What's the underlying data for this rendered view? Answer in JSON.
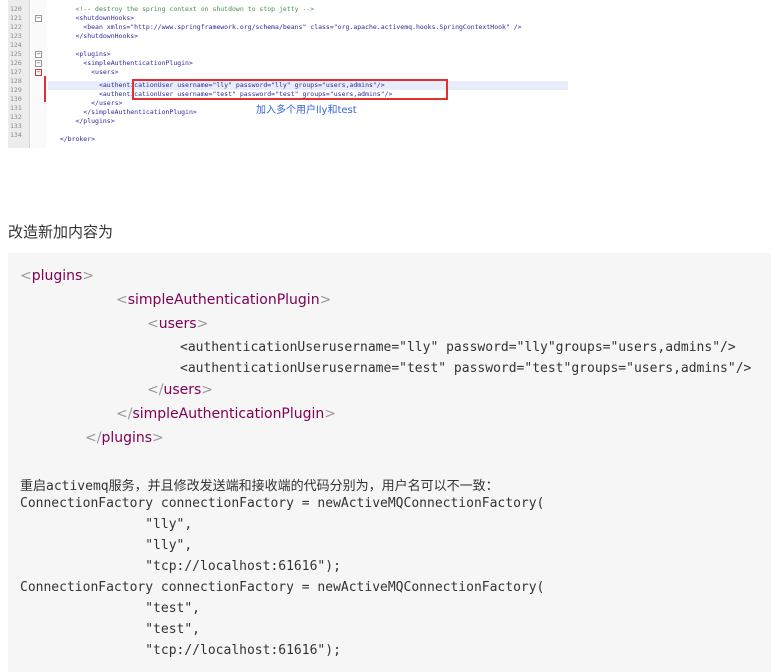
{
  "editor": {
    "line_numbers": [
      "120",
      "121",
      "122",
      "123",
      "124",
      "125",
      "126",
      "127",
      "128",
      "129",
      "130",
      "131",
      "132",
      "133",
      "134"
    ],
    "code_lines": [
      "      <!-- destroy the spring context on shutdown to stop jetty -->",
      "      <shutdownHooks>",
      "        <bean xmlns=\"http://www.springframework.org/schema/beans\" class=\"org.apache.activemq.hooks.SpringContextHook\" />",
      "      </shutdownHooks>",
      "",
      "      <plugins>",
      "        <simpleAuthenticationPlugin>",
      "          <users>",
      "            <authenticationUser username=\"lly\" password=\"lly\" groups=\"users,admins\"/>",
      "            <authenticationUser username=\"test\" password=\"test\" groups=\"users,admins\"/>",
      "          </users>",
      "        </simpleAuthenticationPlugin>",
      "      </plugins>",
      "",
      "  </broker>"
    ],
    "annotation": "加入多个用户lly和test",
    "highlight_color": "#e8ecfb",
    "annotation_border_color": "#e03030",
    "annotation_text_color": "#3366d6"
  },
  "heading": "改造新加内容为",
  "code_block": {
    "xml_lines": [
      {
        "open": "<",
        "tag": "plugins",
        "close": ">"
      },
      {
        "open": "<",
        "tag": "simpleAuthenticationPlugin",
        "close": ">"
      },
      {
        "open": "<",
        "tag": "users",
        "close": ">"
      },
      {
        "text": "<authenticationUserusername=\"lly\" password=\"lly\"groups=\"users,admins\"/>"
      },
      {
        "text": "<authenticationUserusername=\"test\" password=\"test\"groups=\"users,admins\"/>"
      },
      {
        "open": "</",
        "tag": "users",
        "close": ">"
      },
      {
        "open": "</",
        "tag": "simpleAuthenticationPlugin",
        "close": ">"
      },
      {
        "open": "</",
        "tag": "plugins",
        "close": ">"
      }
    ],
    "java_lines": [
      "重启activemq服务，并且修改发送端和接收端的代码分别为，用户名可以不一致：",
      "ConnectionFactory connectionFactory = newActiveMQConnectionFactory(",
      "                \"lly\",",
      "                \"lly\",",
      "                \"tcp://localhost:61616\");",
      "ConnectionFactory connectionFactory = newActiveMQConnectionFactory(",
      "                \"test\",",
      "                \"test\",",
      "                \"tcp://localhost:61616\");"
    ],
    "tag_color": "#800055",
    "bracket_color": "#9a9a9a",
    "background": "#f6f6f6"
  }
}
